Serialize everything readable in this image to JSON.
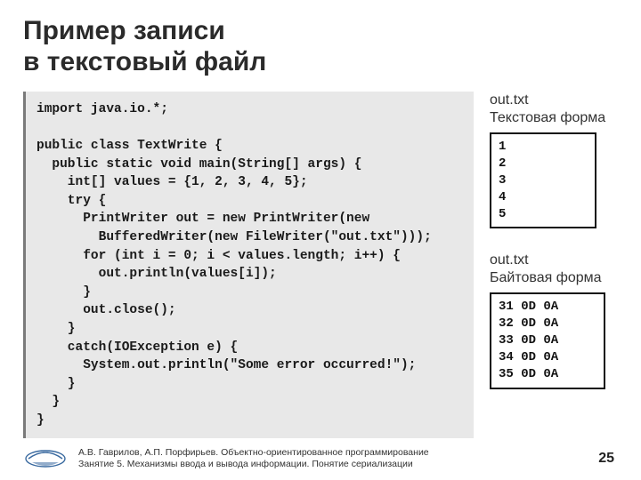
{
  "title_line1": "Пример записи",
  "title_line2": "в текстовый файл",
  "code": "import java.io.*;\n\npublic class TextWrite {\n  public static void main(String[] args) {\n    int[] values = {1, 2, 3, 4, 5};\n    try {\n      PrintWriter out = new PrintWriter(new\n        BufferedWriter(new FileWriter(\"out.txt\")));\n      for (int i = 0; i < values.length; i++) {\n        out.println(values[i]);\n      }\n      out.close();\n    }\n    catch(IOException e) {\n      System.out.println(\"Some error occurred!\");\n    }\n  }\n}",
  "side": {
    "text_label_line1": "out.txt",
    "text_label_line2": "Текстовая форма",
    "text_output": "1\n2\n3\n4\n5",
    "byte_label_line1": "out.txt",
    "byte_label_line2": "Байтовая форма",
    "byte_output": "31 0D 0A\n32 0D 0A\n33 0D 0A\n34 0D 0A\n35 0D 0A"
  },
  "footer": {
    "line1": "А.В. Гаврилов, А.П. Порфирьев. Объектно-ориентированное программирование",
    "line2": "Занятие 5. Механизмы ввода и вывода информации. Понятие сериализации",
    "page": "25"
  }
}
